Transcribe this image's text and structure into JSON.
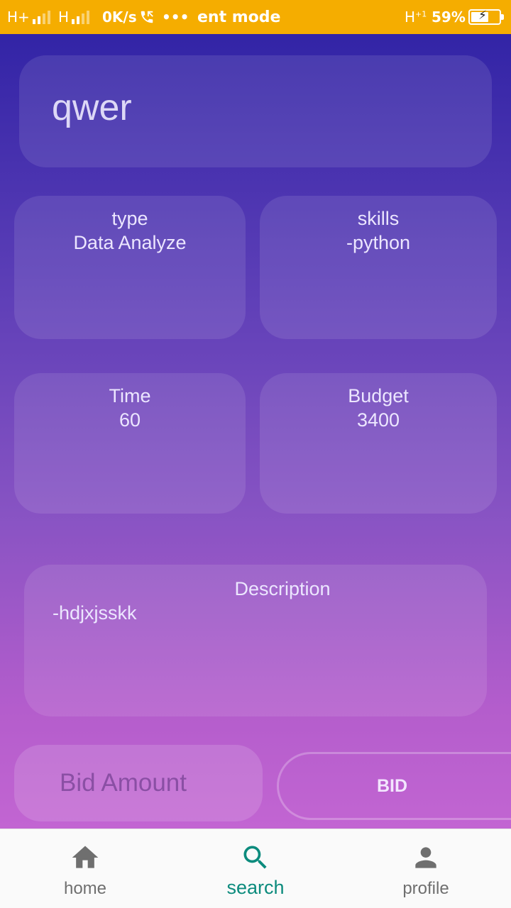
{
  "status_bar": {
    "network1": "H+",
    "network2": "H",
    "speed": "0K/s",
    "notification": "ent mode",
    "network3": "H",
    "network3_sub": "+1",
    "battery": "59%",
    "overflow": "•••"
  },
  "job": {
    "title": "qwer",
    "type_label": "type",
    "type_value": "Data Analyze",
    "skills_label": "skills",
    "skills_value": "-python",
    "time_label": "Time",
    "time_value": "60",
    "budget_label": "Budget",
    "budget_value": "3400",
    "description_label": "Description",
    "description_value": "-hdjxjsskk"
  },
  "bid": {
    "placeholder": "Bid Amount",
    "button_label": "BID"
  },
  "nav": {
    "items": [
      {
        "label": "home",
        "icon": "home-icon"
      },
      {
        "label": "search",
        "icon": "search-icon",
        "active": true
      },
      {
        "label": "profile",
        "icon": "person-icon"
      }
    ]
  },
  "colors": {
    "status_bar": "#f5ad00",
    "gradient_top": "#3224a6",
    "gradient_bottom": "#c265d2",
    "nav_active": "#0c8b7d",
    "nav_inactive": "#6f6f6f"
  }
}
